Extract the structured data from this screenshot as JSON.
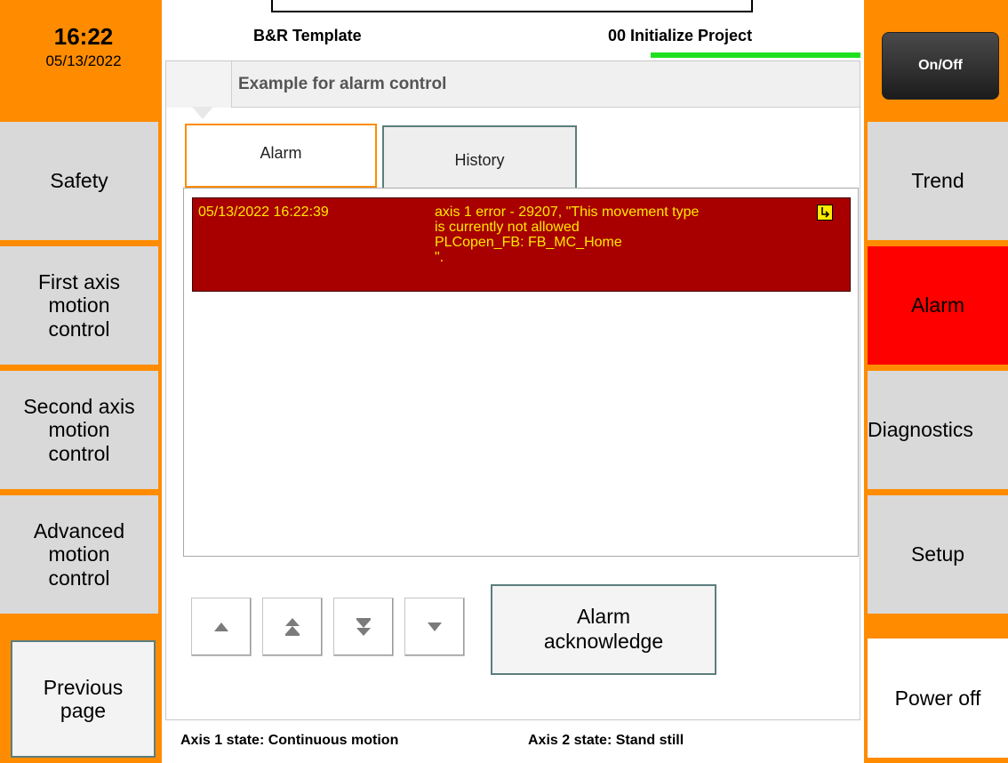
{
  "clock": {
    "time": "16:22",
    "date": "05/13/2022"
  },
  "header": {
    "project_title": "B&R Template",
    "page_name": "00 Initialize Project",
    "panel_title": "Example for alarm control"
  },
  "left_nav": {
    "items": [
      {
        "label": "Safety"
      },
      {
        "label": "First axis\nmotion\ncontrol"
      },
      {
        "label": "Second axis\nmotion\ncontrol"
      },
      {
        "label": "Advanced\nmotion\ncontrol"
      }
    ],
    "previous_label": "Previous\npage"
  },
  "right_nav": {
    "onoff_label": "On/Off",
    "items": [
      {
        "label": "Trend"
      },
      {
        "label": "Alarm",
        "active": true
      },
      {
        "label": "Diagnostics"
      },
      {
        "label": "Setup"
      }
    ],
    "power_off_label": "Power off"
  },
  "tabs": [
    {
      "label": "Alarm",
      "selected": true
    },
    {
      "label": "History",
      "selected": false
    }
  ],
  "alarms": [
    {
      "timestamp": "05/13/2022 16:22:39",
      "message": "axis 1 error - 29207, \"This movement type\nis currently not allowed\n  PLCopen_FB: FB_MC_Home\n                                   \".",
      "status_icon": "unacknowledged-icon"
    }
  ],
  "controls": {
    "ack_label": "Alarm\nacknowledge",
    "scroll_icons": [
      "scroll-up-icon",
      "page-up-icon",
      "page-down-icon",
      "scroll-down-icon"
    ]
  },
  "status_bar": {
    "axis1": "Axis 1 state: Continuous motion",
    "axis2": "Axis 2 state: Stand still"
  },
  "colors": {
    "frame": "#ff8c00",
    "alarm_row_bg": "#a80000",
    "alarm_row_text": "#ffe800",
    "active_nav": "#ff0000",
    "progress": "#1fe01f"
  }
}
